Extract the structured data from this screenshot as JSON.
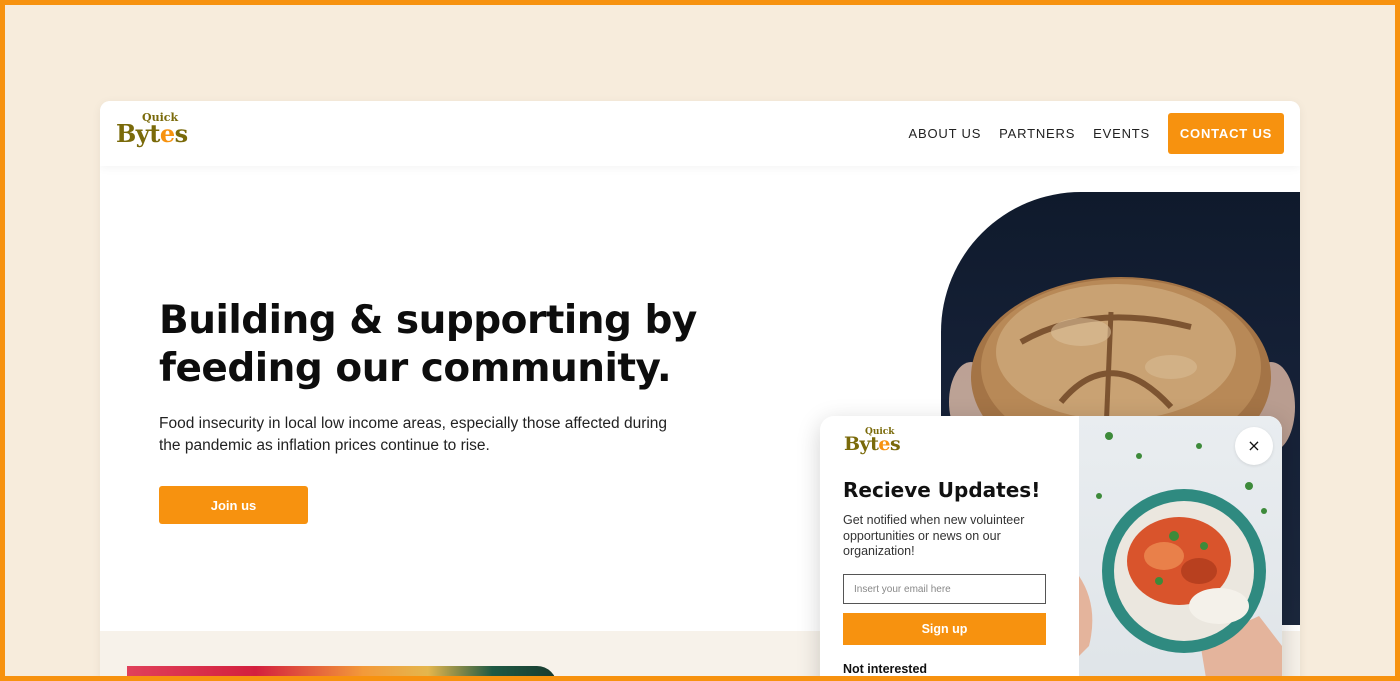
{
  "brand": {
    "logo_small": "Quick",
    "logo_big_part1": "Byt",
    "logo_big_accent": "e",
    "logo_big_part2": "s",
    "color_primary": "#f7920f",
    "color_logo": "#7a6a0a",
    "color_background": "#f7ecdc"
  },
  "nav": {
    "items": [
      {
        "label": "ABOUT US"
      },
      {
        "label": "PARTNERS"
      },
      {
        "label": "EVENTS"
      }
    ],
    "cta_label": "CONTACT US"
  },
  "hero": {
    "title_line1": "Building & supporting by",
    "title_line2": "feeding our community.",
    "description_line1": "Food insecurity in local low income areas, especially those affected during",
    "description_line2": "the pandemic as inflation prices continue to rise.",
    "join_label": "Join us"
  },
  "popup": {
    "title": "Recieve Updates!",
    "desc_line1": "Get notified when new voluinteer",
    "desc_line2": "opportunities or news on our",
    "desc_line3": "organization!",
    "email_placeholder": "Insert your email here",
    "signup_label": "Sign up",
    "not_interested_label": "Not interested",
    "close_icon": "×"
  }
}
